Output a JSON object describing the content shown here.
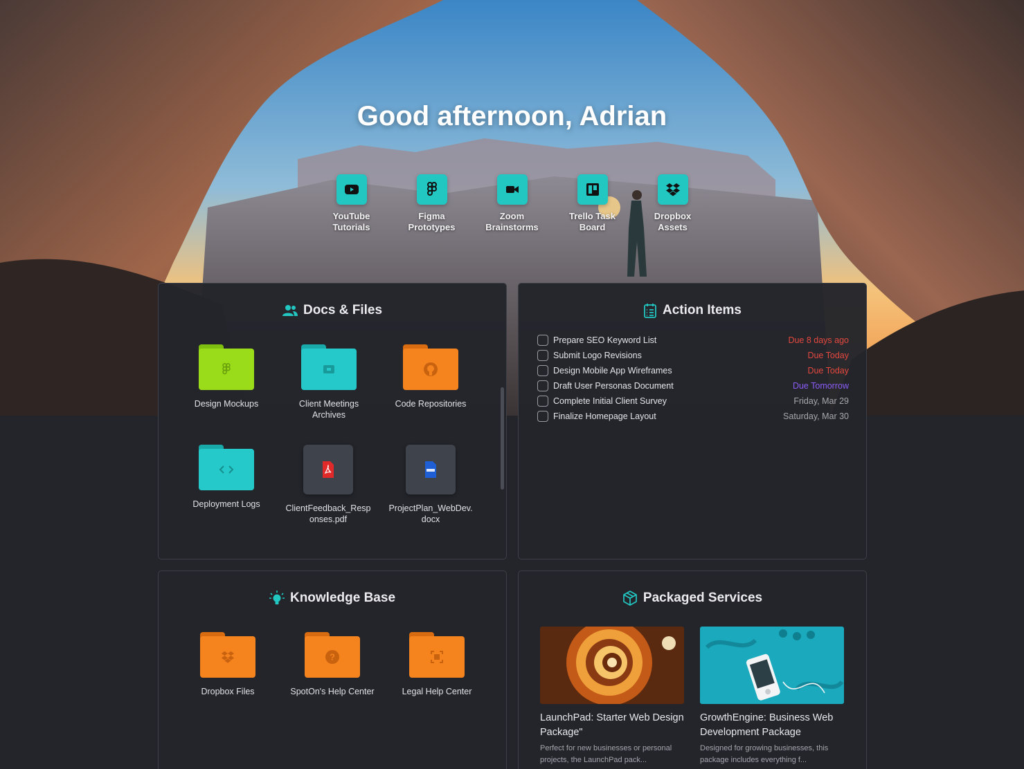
{
  "greeting": "Good afternoon, Adrian",
  "colors": {
    "accent": "#22c7c2",
    "overdue": "#e5483f",
    "tomorrow": "#8b5cf6",
    "neutral_due": "#a6a8ae",
    "folder_green": "#9bdc1a",
    "folder_teal": "#26c9c9",
    "folder_orange": "#f5841f"
  },
  "shortcuts": [
    {
      "label": "YouTube Tutorials",
      "icon": "youtube-icon"
    },
    {
      "label": "Figma Prototypes",
      "icon": "figma-icon"
    },
    {
      "label": "Zoom Brainstorms",
      "icon": "video-camera-icon"
    },
    {
      "label": "Trello Task Board",
      "icon": "trello-icon"
    },
    {
      "label": "Dropbox Assets",
      "icon": "dropbox-icon"
    }
  ],
  "docs": {
    "title": "Docs & Files",
    "icon": "people-icon",
    "items": [
      {
        "label": "Design Mockups",
        "type": "folder",
        "color": "green",
        "icon": "figma-icon"
      },
      {
        "label": "Client Meetings Archives",
        "type": "folder",
        "color": "teal",
        "icon": "archive-icon"
      },
      {
        "label": "Code Repositories",
        "type": "folder",
        "color": "orange",
        "icon": "github-icon"
      },
      {
        "label": "Deployment Logs",
        "type": "folder",
        "color": "teal",
        "icon": "code-icon"
      },
      {
        "label": "ClientFeedback_Responses.pdf",
        "type": "file",
        "icon": "pdf-icon"
      },
      {
        "label": "ProjectPlan_WebDev.docx",
        "type": "file",
        "icon": "doc-icon"
      }
    ]
  },
  "actions": {
    "title": "Action Items",
    "icon": "checklist-icon",
    "items": [
      {
        "name": "Prepare SEO Keyword List",
        "due": "Due 8 days ago",
        "status": "overdue"
      },
      {
        "name": "Submit Logo Revisions",
        "due": "Due Today",
        "status": "overdue"
      },
      {
        "name": "Design Mobile App Wireframes",
        "due": "Due Today",
        "status": "overdue"
      },
      {
        "name": "Draft User Personas Document",
        "due": "Due Tomorrow",
        "status": "tomorrow"
      },
      {
        "name": "Complete Initial Client Survey",
        "due": "Friday, Mar 29",
        "status": "upcoming"
      },
      {
        "name": "Finalize Homepage Layout",
        "due": "Saturday, Mar 30",
        "status": "upcoming"
      }
    ]
  },
  "knowledge": {
    "title": "Knowledge Base",
    "icon": "lightbulb-icon",
    "items": [
      {
        "label": "Dropbox Files",
        "icon": "dropbox-icon"
      },
      {
        "label": "SpotOn's Help Center",
        "icon": "question-icon"
      },
      {
        "label": "Legal Help Center",
        "icon": "frame-icon"
      }
    ]
  },
  "packages": {
    "title": "Packaged Services",
    "icon": "package-icon",
    "items": [
      {
        "title": "LaunchPad: Starter Web Design Package\"",
        "desc": "Perfect for new businesses or personal projects, the LaunchPad pack..."
      },
      {
        "title": "GrowthEngine: Business Web Development Package",
        "desc": "Designed for growing businesses, this package includes everything f..."
      }
    ]
  }
}
